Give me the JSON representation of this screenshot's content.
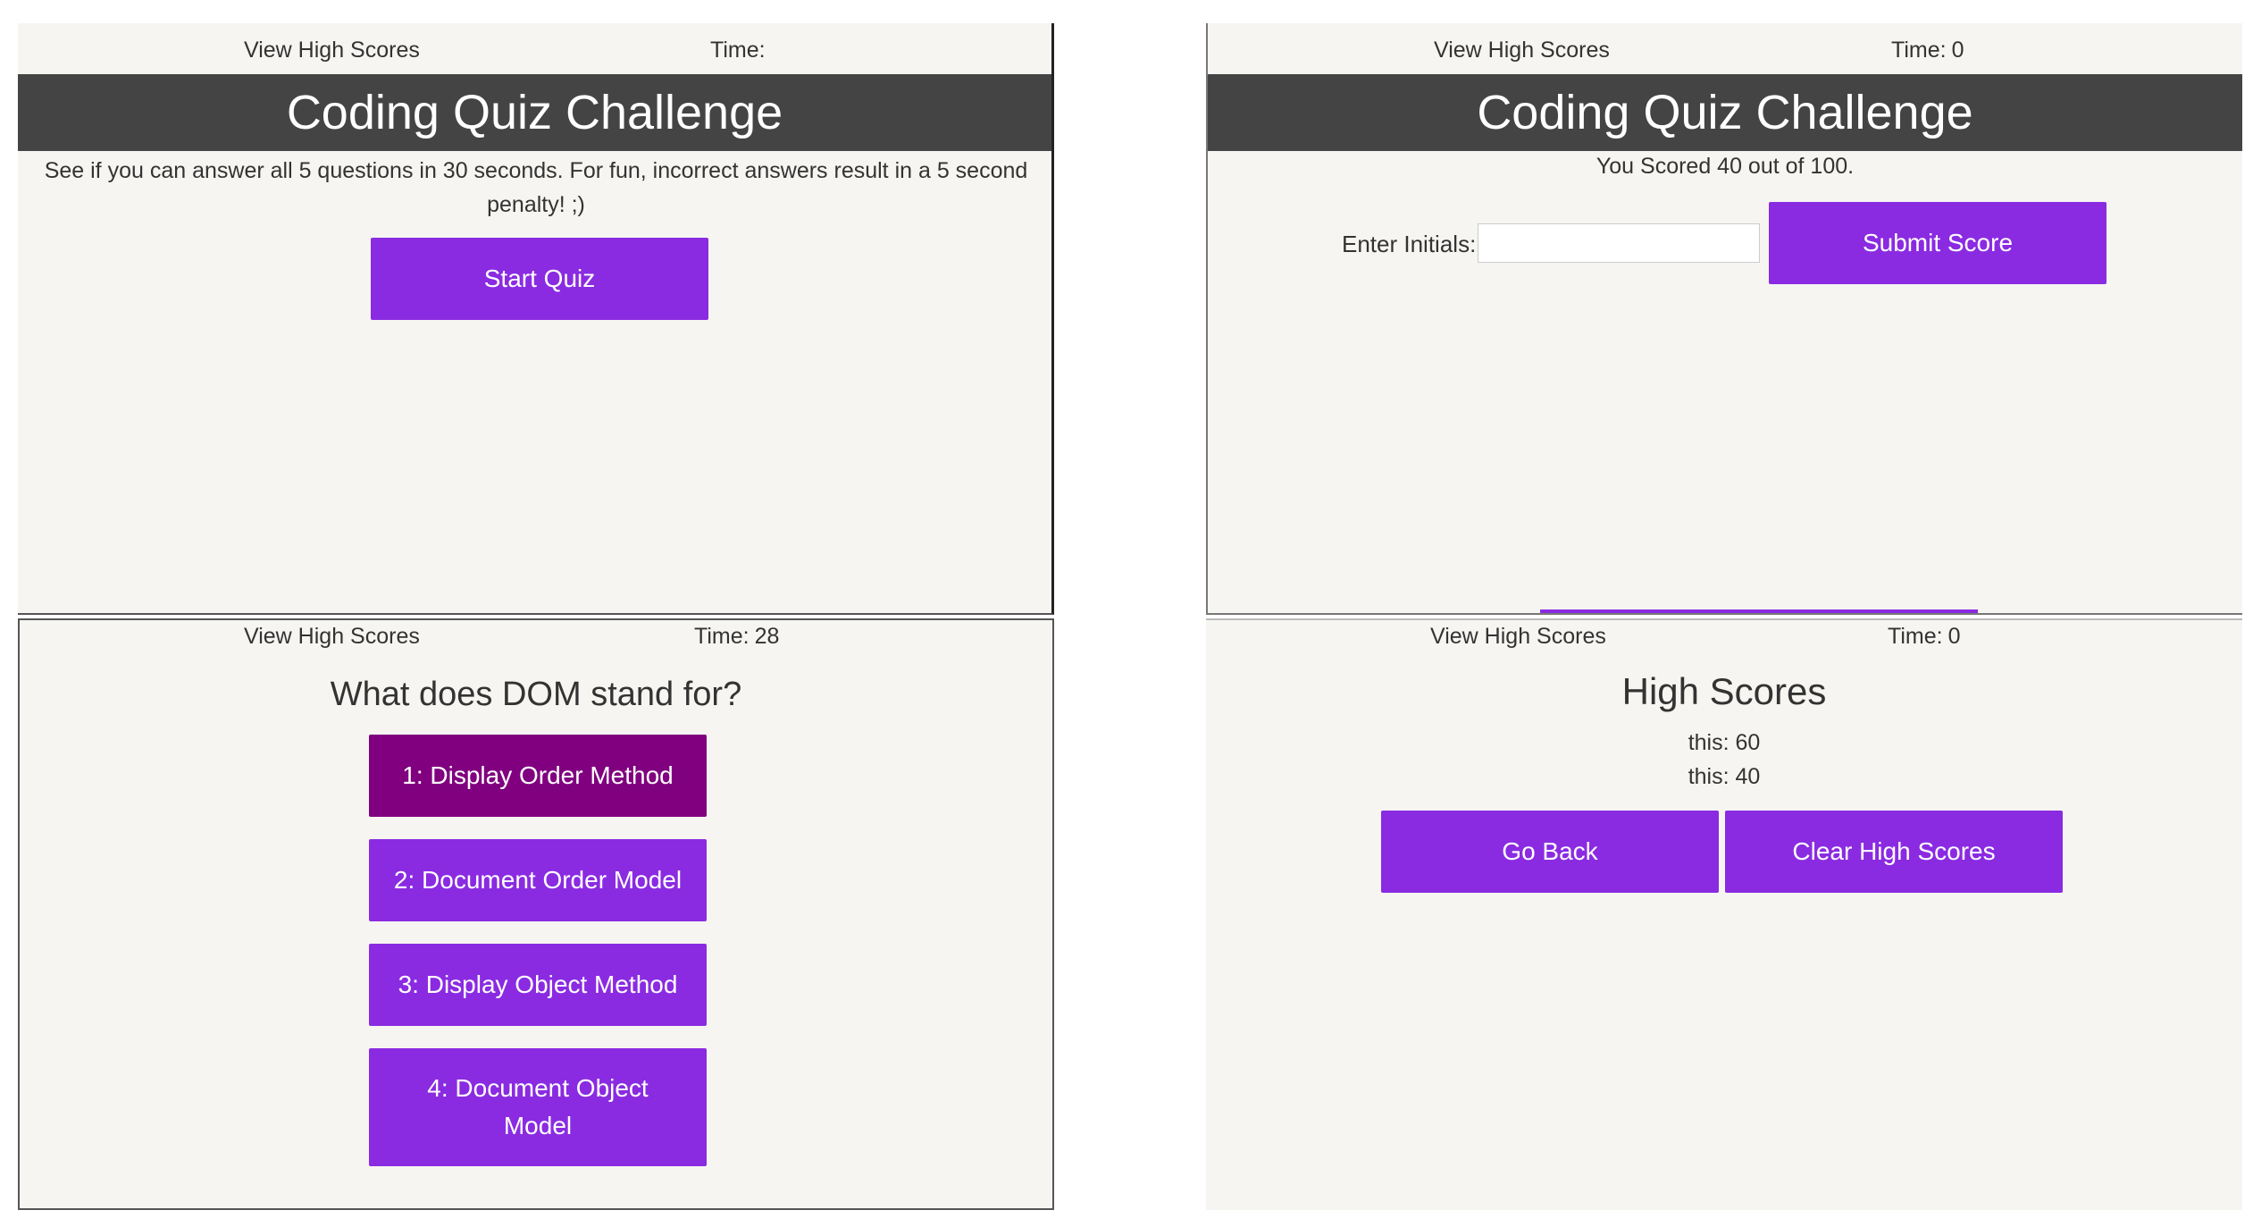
{
  "colors": {
    "accent": "#8a2be2",
    "accent_selected": "#800080",
    "header_bg": "#444444",
    "panel_bg": "#f6f5f1"
  },
  "start_screen": {
    "view_high_scores": "View High Scores",
    "time_label": "Time:",
    "time_value": "",
    "title": "Coding Quiz Challenge",
    "intro": "See if you can answer all 5 questions in 30 seconds. For fun, incorrect answers result in a 5 second penalty! ;)",
    "start_button": "Start Quiz"
  },
  "score_screen": {
    "view_high_scores": "View High Scores",
    "time_label": "Time:",
    "time_value": "0",
    "title": "Coding Quiz Challenge",
    "result": "You Scored 40 out of 100.",
    "initials_label": "Enter Initials:",
    "initials_value": "",
    "submit_button": "Submit Score"
  },
  "question_screen": {
    "view_high_scores": "View High Scores",
    "time_label": "Time:",
    "time_value": "28",
    "question": "What does DOM stand for?",
    "answers": [
      "1: Display Order Method",
      "2: Document Order Model",
      "3: Display Object Method",
      "4: Document Object Model"
    ],
    "selected_answer_index": 0
  },
  "high_scores_screen": {
    "view_high_scores": "View High Scores",
    "time_label": "Time:",
    "time_value": "0",
    "title": "High Scores",
    "scores": [
      "this: 60",
      "this: 40"
    ],
    "go_back_button": "Go Back",
    "clear_button": "Clear High Scores"
  }
}
